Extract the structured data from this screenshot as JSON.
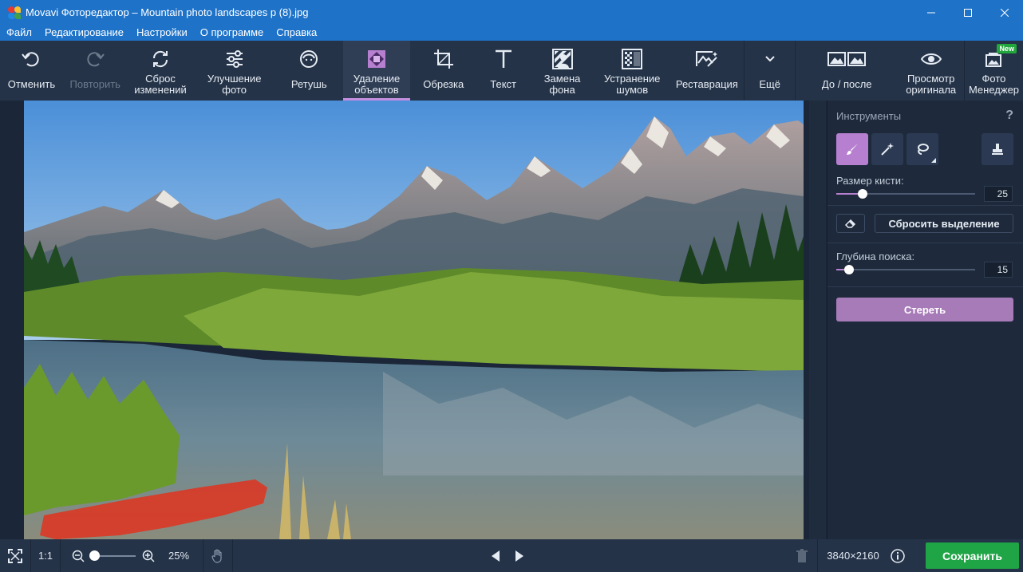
{
  "window": {
    "title": "Movavi Фоторедактор – Mountain photo landscapes p (8).jpg"
  },
  "menu": [
    "Файл",
    "Редактирование",
    "Настройки",
    "О программе",
    "Справка"
  ],
  "toolbar": {
    "undo": "Отменить",
    "redo": "Повторить",
    "reset": "Сброс изменений",
    "enhance": "Улучшение фото",
    "retouch": "Ретушь",
    "object_removal": "Удаление объектов",
    "crop": "Обрезка",
    "text": "Текст",
    "bg_replace": "Замена фона",
    "denoise": "Устранение шумов",
    "restoration": "Реставрация",
    "more": "Ещё",
    "before_after": "До / после",
    "view_original": "Просмотр оригинала",
    "photo_manager": "Фото Менеджер",
    "new_badge": "New"
  },
  "panel": {
    "title": "Инструменты",
    "help": "?",
    "brush_size_label": "Размер кисти:",
    "brush_size_value": "25",
    "brush_size_level": 0.19,
    "reset_selection": "Сбросить выделение",
    "search_depth_label": "Глубина поиска:",
    "search_depth_value": "15",
    "search_depth_level": 0.09,
    "erase": "Стереть"
  },
  "status": {
    "ratio": "1:1",
    "zoom": "25%",
    "resolution": "3840×2160",
    "save": "Сохранить"
  },
  "colors": {
    "accent": "#b77fd0",
    "titlebar": "#1e73c9",
    "save": "#1fa546",
    "selection": "#e0321e"
  }
}
